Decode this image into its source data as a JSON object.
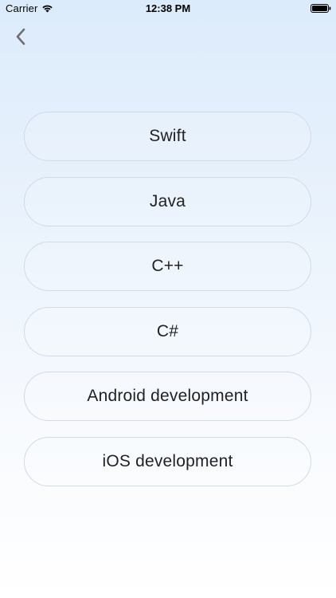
{
  "status_bar": {
    "carrier": "Carrier",
    "time": "12:38 PM",
    "wifi_icon": "wifi-icon",
    "battery_icon": "battery-icon"
  },
  "nav": {
    "back_icon": "chevron-left-icon"
  },
  "options": [
    {
      "label": "Swift"
    },
    {
      "label": "Java"
    },
    {
      "label": "C++"
    },
    {
      "label": "C#"
    },
    {
      "label": "Android development"
    },
    {
      "label": "iOS development"
    }
  ],
  "colors": {
    "background_top": "#dcebfb",
    "background_bottom": "#ffffff",
    "button_border": "#cfdbe7",
    "back_icon": "#6e6e73"
  }
}
